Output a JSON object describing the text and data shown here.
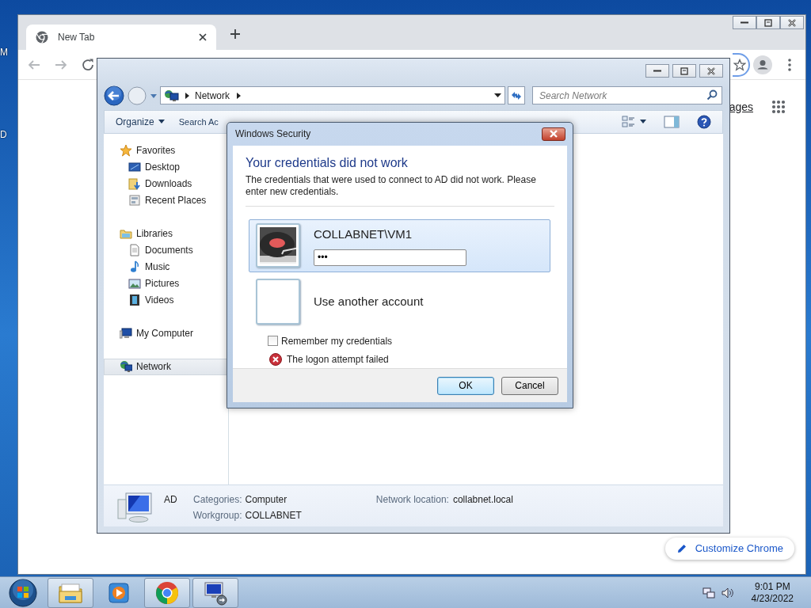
{
  "desktop": {
    "icon_labels": [
      "M",
      "D"
    ]
  },
  "browser": {
    "tabs": [
      {
        "label": "New Tab",
        "selected": true
      }
    ],
    "partial_link": "ages",
    "customize_button": "Customize Chrome"
  },
  "explorer": {
    "breadcrumb": "Network",
    "search": {
      "placeholder": "Search Network"
    },
    "commands": [
      {
        "label": "Organize",
        "dropdown": true
      },
      {
        "label": "Search Ac",
        "dropdown": false
      }
    ],
    "nav": [
      {
        "label": "Favorites",
        "selected": false,
        "children": [
          {
            "label": "Desktop",
            "selected": false
          },
          {
            "label": "Downloads",
            "selected": false
          },
          {
            "label": "Recent Places",
            "selected": false
          }
        ]
      },
      {
        "label": "Libraries",
        "selected": false,
        "children": [
          {
            "label": "Documents",
            "selected": false
          },
          {
            "label": "Music",
            "selected": false
          },
          {
            "label": "Pictures",
            "selected": false
          },
          {
            "label": "Videos",
            "selected": false
          }
        ]
      },
      {
        "label": "My Computer",
        "selected": false
      },
      {
        "label": "Network",
        "selected": true
      }
    ],
    "details": {
      "name": "AD",
      "fields": [
        {
          "label": "Categories:",
          "value": "Computer"
        },
        {
          "label": "Workgroup:",
          "value": "COLLABNET"
        }
      ],
      "location": {
        "label": "Network location:",
        "value": "collabnet.local"
      }
    }
  },
  "dialog": {
    "title": "Windows Security",
    "heading": "Your credentials did not work",
    "message": "The credentials that were used to connect to AD did not work. Please enter new credentials.",
    "accounts": [
      {
        "kind": "account",
        "name": "COLLABNET\\VM1",
        "password": "•••",
        "selected": true
      },
      {
        "kind": "other",
        "name": "Use another account",
        "selected": false
      }
    ],
    "remember": {
      "label": "Remember my credentials",
      "checked": false
    },
    "error": "The logon attempt failed",
    "buttons": [
      {
        "label": "OK",
        "default": true
      },
      {
        "label": "Cancel",
        "default": false
      }
    ]
  },
  "taskbar": {
    "apps": [
      {
        "kind": "explorer",
        "running": true
      },
      {
        "kind": "media",
        "running": false
      },
      {
        "kind": "chrome",
        "running": true
      },
      {
        "kind": "remote",
        "running": true
      }
    ],
    "clock": {
      "time": "9:01 PM",
      "date": "4/23/2022"
    }
  }
}
